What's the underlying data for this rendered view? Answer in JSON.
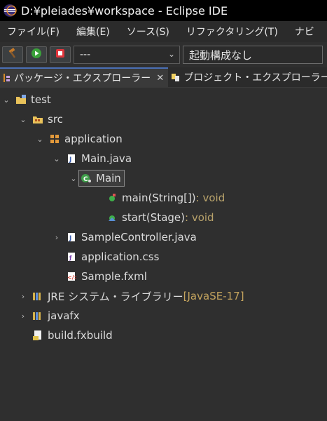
{
  "window": {
    "title": "D:¥pleiades¥workspace - Eclipse IDE"
  },
  "menu": [
    {
      "label": "ファイル(F)"
    },
    {
      "label": "編集(E)"
    },
    {
      "label": "ソース(S)"
    },
    {
      "label": "リファクタリング(T)"
    },
    {
      "label": "ナビ"
    }
  ],
  "toolbar": {
    "mode_value": "---",
    "launch_config_value": "起動構成なし"
  },
  "tabs": [
    {
      "label": "パッケージ・エクスプローラー",
      "active": true
    },
    {
      "label": "プロジェクト・エクスプローラー",
      "active": false
    }
  ],
  "tree": {
    "project": "test",
    "src": "src",
    "package": "application",
    "main_java": "Main.java",
    "main_class": "Main",
    "method_main": "main(String[])",
    "method_main_return": " : void",
    "method_start": "start(Stage)",
    "method_start_return": " : void",
    "sample_controller": "SampleController.java",
    "app_css": "application.css",
    "sample_fxml": "Sample.fxml",
    "jre": "JRE システム・ライブラリー ",
    "jre_version": "[JavaSE-17]",
    "javafx": "javafx",
    "build_fxbuild": "build.fxbuild"
  },
  "colors": {
    "titlebar": "#000000",
    "background": "#2f2f2f",
    "accent": "#4a6fb5",
    "type_text": "#b9a36b"
  }
}
